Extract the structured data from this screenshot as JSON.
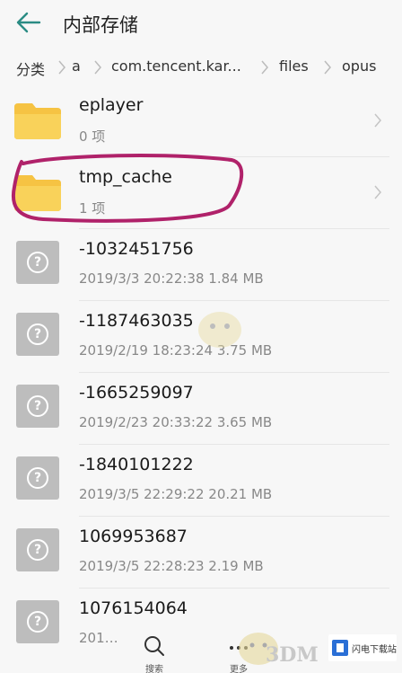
{
  "header": {
    "title": "内部存储",
    "back_icon": "arrow-left-icon"
  },
  "breadcrumb": [
    "分类",
    "a",
    "com.tencent.kar...",
    "files",
    "opus"
  ],
  "items": [
    {
      "type": "folder",
      "name": "eplayer",
      "meta": "0 项"
    },
    {
      "type": "folder",
      "name": "tmp_cache",
      "meta": "1 项"
    },
    {
      "type": "file",
      "name": "-1032451756",
      "meta": "2019/3/3 20:22:38 1.84 MB"
    },
    {
      "type": "file",
      "name": "-1187463035",
      "meta": "2019/2/19 18:23:24 3.75 MB"
    },
    {
      "type": "file",
      "name": "-1665259097",
      "meta": "2019/2/23 20:33:22 3.65 MB"
    },
    {
      "type": "file",
      "name": "-1840101222",
      "meta": "2019/3/5 22:29:22 20.21 MB"
    },
    {
      "type": "file",
      "name": "1069953687",
      "meta": "2019/3/5 22:28:23 2.19 MB"
    },
    {
      "type": "file",
      "name": "1076154064",
      "meta": "201…"
    }
  ],
  "bottom_bar": {
    "search_label": "搜索",
    "more_label": "更多"
  },
  "watermark": {
    "brand": "3DM",
    "site": "闪电下载站"
  },
  "colors": {
    "folder": "#f6c343",
    "accent": "#2b8c84",
    "annotation": "#b0226a"
  }
}
